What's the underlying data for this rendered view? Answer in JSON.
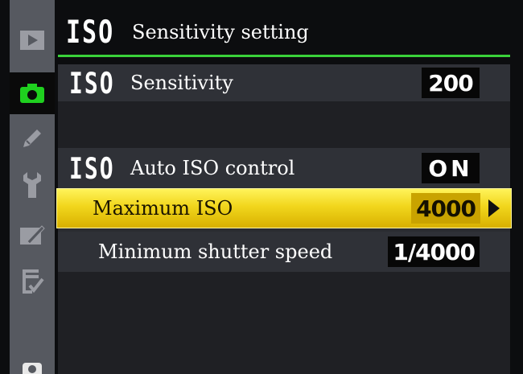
{
  "colors": {
    "accent_green": "#3ad23a",
    "highlight_yellow": "#f1d61c",
    "sidebar_gray": "#565960"
  },
  "sidebar": {
    "items": [
      {
        "icon": "playback-icon",
        "active": false
      },
      {
        "icon": "camera-icon",
        "active": true
      },
      {
        "icon": "pencil-icon",
        "active": false
      },
      {
        "icon": "wrench-icon",
        "active": false
      },
      {
        "icon": "retouch-icon",
        "active": false
      },
      {
        "icon": "my-menu-icon",
        "active": false
      },
      {
        "icon": "help-icon",
        "active": false
      }
    ]
  },
  "header": {
    "icon_text": "ISO",
    "title": "Sensitivity setting"
  },
  "rows": {
    "sensitivity": {
      "icon_text": "ISO",
      "label": "Sensitivity",
      "value": "200"
    },
    "auto_iso": {
      "icon_text": "ISO",
      "label": "Auto ISO control",
      "value": "ON"
    },
    "max_iso": {
      "label": "Maximum ISO",
      "value": "4000"
    },
    "min_shutter": {
      "label": "Minimum shutter speed",
      "value": "1/4000"
    }
  }
}
